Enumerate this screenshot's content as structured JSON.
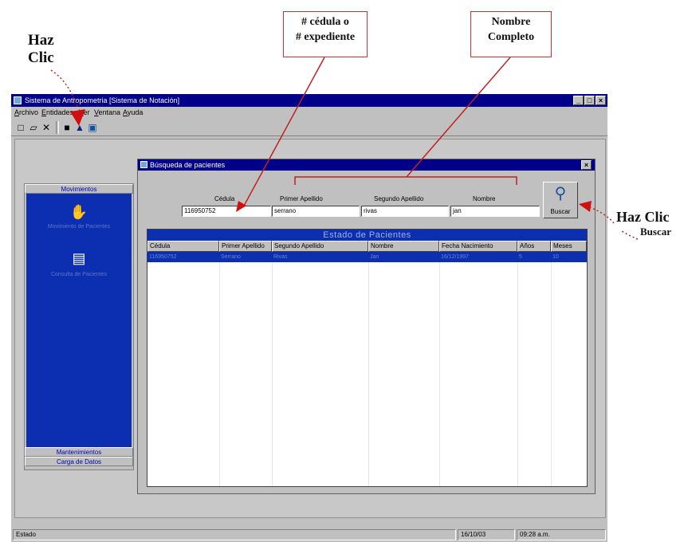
{
  "annotations": {
    "haz_clic_top": "Haz\nClic",
    "cedula_box": "# cédula o\n# expediente",
    "nombre_box": "Nombre\nCompleto",
    "haz_clic_right": "Haz Clic",
    "buscar_right": "Buscar"
  },
  "window": {
    "title": "Sistema de Antropometria [Sistema de Notación]",
    "controls": [
      "_",
      "□",
      "×"
    ]
  },
  "menu": [
    "Archivo",
    "Entidades",
    "Ver",
    "Ventana",
    "Ayuda"
  ],
  "toolbar": [
    {
      "name": "new-file-icon",
      "glyph": "□"
    },
    {
      "name": "open-folder-icon",
      "glyph": "▱"
    },
    {
      "name": "delete-icon",
      "glyph": "✕"
    },
    {
      "name": "save-icon",
      "glyph": "■"
    },
    {
      "name": "binoculars-icon",
      "glyph": "▲"
    },
    {
      "name": "exit-icon",
      "glyph": "▣"
    }
  ],
  "sidebar": {
    "header_top": "Movimientos",
    "items": [
      {
        "name": "handshake-icon",
        "glyph": "✋",
        "label": "Movimiento de Pacientes"
      },
      {
        "name": "book-icon",
        "glyph": "▤",
        "label": "Consulta de Pacientes"
      }
    ],
    "footer_items": [
      "Mantenimientos",
      "Carga de Datos"
    ]
  },
  "dialog": {
    "title": "Búsqueda de pacientes",
    "close": "×",
    "labels": {
      "cedula": "Cédula",
      "primer_apellido": "Primer Apellido",
      "segundo_apellido": "Segundo Apellido",
      "nombre": "Nombre"
    },
    "values": {
      "cedula": "116950752",
      "primer_apellido": "serrano",
      "segundo_apellido": "rivas",
      "nombre": "jan"
    },
    "search_button": "Buscar",
    "grid_caption": "Estado de Pacientes",
    "columns": [
      "Cédula",
      "Primer Apellido",
      "Segundo Apellido",
      "Nombre",
      "Fecha Nacimiento",
      "Años",
      "Meses"
    ],
    "selected_row": [
      "116950752",
      "Serrano",
      "Rivas",
      "Jan",
      "16/12/1997",
      "5",
      "10"
    ]
  },
  "statusbar": {
    "state": "Estado",
    "date": "16/10/03",
    "time": "09:28 a.m."
  }
}
